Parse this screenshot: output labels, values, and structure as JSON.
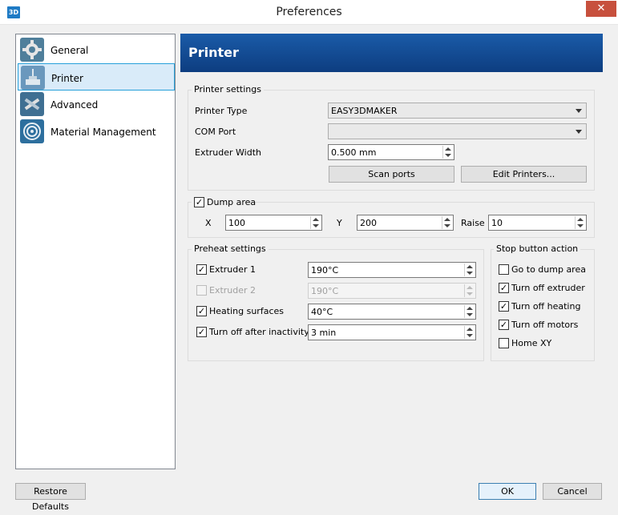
{
  "window": {
    "title": "Preferences",
    "app_icon": "3D",
    "close_glyph": "✕"
  },
  "sidebar": {
    "items": [
      {
        "label": "General",
        "icon": "gear-icon",
        "selected": false
      },
      {
        "label": "Printer",
        "icon": "printer-icon",
        "selected": true
      },
      {
        "label": "Advanced",
        "icon": "tools-icon",
        "selected": false
      },
      {
        "label": "Material Management",
        "icon": "filament-icon",
        "selected": false
      }
    ]
  },
  "header": {
    "title": "Printer"
  },
  "printer_settings": {
    "title": "Printer settings",
    "printer_type_label": "Printer Type",
    "printer_type_value": "EASY3DMAKER",
    "com_port_label": "COM Port",
    "com_port_value": "",
    "extruder_width_label": "Extruder Width",
    "extruder_width_value": "0.500 mm",
    "scan_ports_label": "Scan ports",
    "edit_printers_label": "Edit Printers..."
  },
  "dump_area": {
    "label": "Dump area",
    "checked": true,
    "x_label": "X",
    "x_value": "100",
    "y_label": "Y",
    "y_value": "200",
    "raise_label": "Raise",
    "raise_value": "10"
  },
  "preheat": {
    "title": "Preheat settings",
    "rows": [
      {
        "label": "Extruder 1",
        "checked": true,
        "enabled": true,
        "value": "190°C"
      },
      {
        "label": "Extruder 2",
        "checked": false,
        "enabled": false,
        "value": "190°C"
      },
      {
        "label": "Heating surfaces",
        "checked": true,
        "enabled": true,
        "value": "40°C"
      },
      {
        "label": "Turn off after inactivity",
        "checked": true,
        "enabled": true,
        "value": "3 min"
      }
    ]
  },
  "stop_action": {
    "title": "Stop button action",
    "options": [
      {
        "label": "Go to dump area",
        "checked": false
      },
      {
        "label": "Turn off extruder",
        "checked": true
      },
      {
        "label": "Turn off heating",
        "checked": true
      },
      {
        "label": "Turn off motors",
        "checked": true
      },
      {
        "label": "Home XY",
        "checked": false
      }
    ]
  },
  "footer": {
    "restore_label": "Restore Defaults",
    "ok_label": "OK",
    "cancel_label": "Cancel"
  },
  "check_glyph": "✓",
  "colors": {
    "header_bg": "#1a5ba8",
    "selection": "#d9ebf9",
    "close": "#c7503d"
  }
}
